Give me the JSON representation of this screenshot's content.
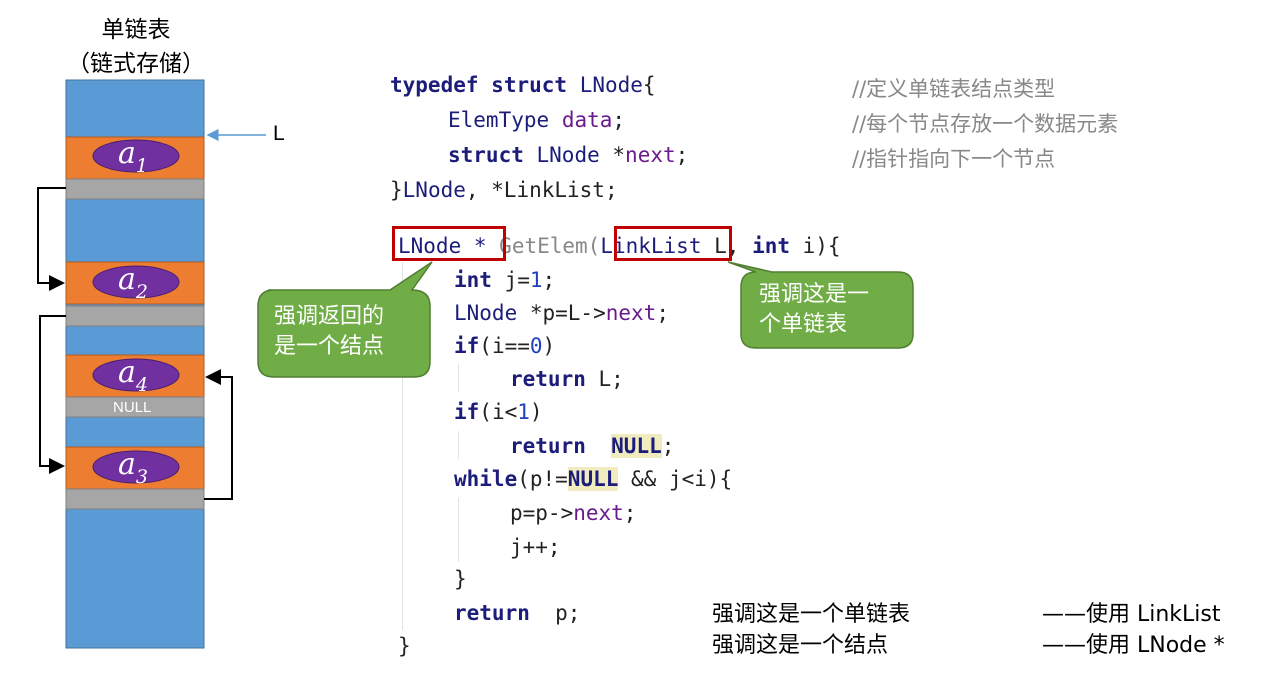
{
  "memory": {
    "title_line1": "单链表",
    "title_line2": "（链式存储）",
    "head_pointer_label": "L",
    "nodes": [
      {
        "label": "a",
        "sub": "1"
      },
      {
        "label": "a",
        "sub": "2"
      },
      {
        "label": "a",
        "sub": "4"
      },
      {
        "label": "a",
        "sub": "3"
      }
    ],
    "null_label": "NULL",
    "colors": {
      "memory": "#5b9bd5",
      "data_cell": "#ed7d31",
      "pointer_cell": "#a6a6a6",
      "node_oval": "#7030a0"
    }
  },
  "code": {
    "struct_l1": {
      "kw1": "typedef",
      "kw2": "struct",
      "name": "LNode",
      "brace": "{"
    },
    "struct_l2": {
      "type": "ElemType",
      "field": "data",
      "end": ";"
    },
    "struct_l3": {
      "kw": "struct",
      "type": "LNode",
      "star": "*",
      "field": "next",
      "end": ";"
    },
    "struct_l4": {
      "brace": "}",
      "type": "LNode",
      "rest": ", *LinkList;"
    },
    "comments": [
      "//定义单链表结点类型",
      "//每个节点存放一个数据元素",
      "//指针指向下一个节点"
    ],
    "func_ret": "LNode *",
    "func_name": "GetElem(",
    "func_param_type": "LinkList",
    "func_rest1": " L, ",
    "func_kw_int": "int",
    "func_rest2": " i){",
    "body": {
      "l1_kw": "int",
      "l1_a": " j=",
      "l1_num": "1",
      "l1_b": ";",
      "l2_type": "LNode",
      "l2_a": " *p=L->",
      "l2_field": "next",
      "l2_b": ";",
      "l3_kw": "if",
      "l3_a": "(i==",
      "l3_num": "0",
      "l3_b": ")",
      "l4_kw": "return",
      "l4_a": " L;",
      "l5_kw": "if",
      "l5_a": "(i<",
      "l5_num": "1",
      "l5_b": ")",
      "l6_kw": "return",
      "l6_null": "NULL",
      "l6_b": ";",
      "l7_kw": "while",
      "l7_a": "(p!=",
      "l7_null": "NULL",
      "l7_b": " && j<i){",
      "l8_a": "p=p->",
      "l8_field": "next",
      "l8_b": ";",
      "l9": "j++;",
      "l10": "}",
      "l11_kw": "return",
      "l11_a": "  p;",
      "l12": "}"
    }
  },
  "callouts": {
    "left": [
      "强调返回的",
      "是一个结点"
    ],
    "right": [
      "强调这是一",
      "个单链表"
    ],
    "color": "#70ad47",
    "box_color": "#c00000"
  },
  "notes": [
    {
      "left": "强调这是一个单链表",
      "right": "——使用 LinkList"
    },
    {
      "left": "强调这是一个结点",
      "right": "——使用 LNode *"
    }
  ]
}
